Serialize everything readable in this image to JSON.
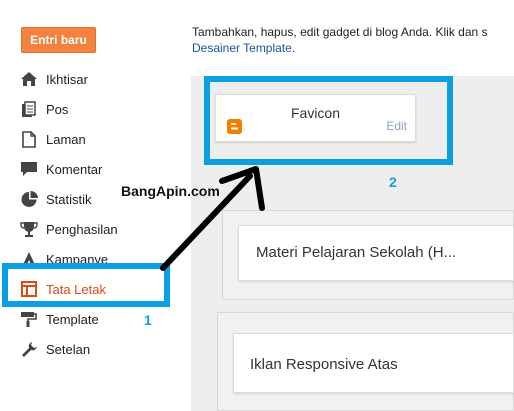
{
  "header": {
    "new_post_label": "Entri baru",
    "intro_text": "Tambahkan, hapus, edit gadget di blog Anda. Klik dan s",
    "intro_link": "Desainer Template."
  },
  "sidebar": {
    "items": [
      {
        "label": "Ikhtisar",
        "icon": "home-icon"
      },
      {
        "label": "Pos",
        "icon": "posts-icon"
      },
      {
        "label": "Laman",
        "icon": "pages-icon"
      },
      {
        "label": "Komentar",
        "icon": "comment-icon"
      },
      {
        "label": "Statistik",
        "icon": "stats-icon"
      },
      {
        "label": "Penghasilan",
        "icon": "trophy-icon"
      },
      {
        "label": "Kampanye",
        "icon": "campaign-icon"
      },
      {
        "label": "Tata Letak",
        "icon": "layout-icon"
      },
      {
        "label": "Template",
        "icon": "paint-roller-icon"
      },
      {
        "label": "Setelan",
        "icon": "wrench-icon"
      }
    ],
    "active_item": "Tata Letak"
  },
  "layout": {
    "favicon_gadget": {
      "title": "Favicon",
      "edit_label": "Edit"
    },
    "gadgets": [
      {
        "title": "Materi Pelajaran Sekolah (H..."
      },
      {
        "title": "Iklan Responsive Atas"
      }
    ]
  },
  "annotations": {
    "step1": "1",
    "step2": "2",
    "watermark": "BangApin.com",
    "highlight_color": "#0a9ee3"
  },
  "colors": {
    "accent": "#f3823f",
    "active_text": "#dd4b11",
    "link": "#1a55a8",
    "blogger_orange": "#f57d00"
  }
}
